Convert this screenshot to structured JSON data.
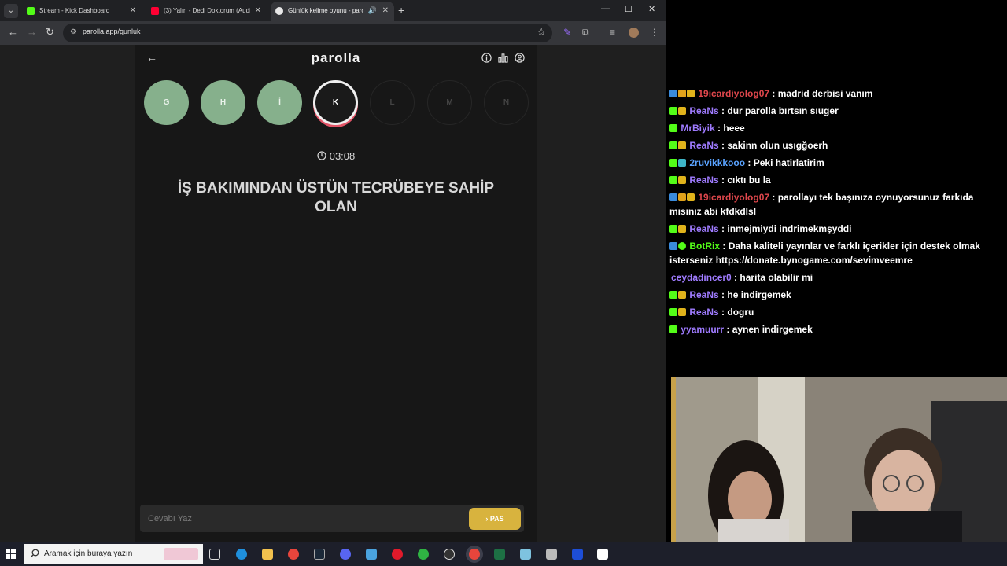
{
  "browser": {
    "tabs": [
      {
        "title": "Stream - Kick Dashboard",
        "active": false,
        "favicon_color": "#53fc18"
      },
      {
        "title": "(3) Yalın - Dedi Doktorum (Audi",
        "active": false,
        "favicon_color": "#ff0033"
      },
      {
        "title": "Günlük kelime oyunu - parc",
        "active": true,
        "favicon_color": "#e8e8e8"
      }
    ],
    "url": "parolla.app/gunluk"
  },
  "app": {
    "logo": "parolla",
    "letters": [
      {
        "char": "G",
        "state": "done"
      },
      {
        "char": "H",
        "state": "done"
      },
      {
        "char": "İ",
        "state": "done"
      },
      {
        "char": "K",
        "state": "current"
      },
      {
        "char": "L",
        "state": "pending"
      },
      {
        "char": "M",
        "state": "pending"
      },
      {
        "char": "N",
        "state": "pending"
      }
    ],
    "timer": "03:08",
    "question": "İŞ BAKIMINDAN ÜSTÜN TECRÜBEYE SAHİP OLAN",
    "answer_placeholder": "Cevabı Yaz",
    "pass_label": "PAS",
    "colors": {
      "done": "#86b08c",
      "current_ring": "#e45568",
      "pass": "#d8b33e"
    }
  },
  "chat": {
    "messages": [
      {
        "user": "19icardiyolog07",
        "color": "#e0474c",
        "text": "madrid derbisi vanım"
      },
      {
        "user": "ReaNs",
        "color": "#9f7bff",
        "text": "dur parolla bırtsın sıuger"
      },
      {
        "user": "MrBiyik",
        "color": "#9f7bff",
        "text": "heee"
      },
      {
        "user": "ReaNs",
        "color": "#9f7bff",
        "text": "sakinn olun usıgğoerh"
      },
      {
        "user": "2ruvikkkooo",
        "color": "#5aa3ff",
        "text": "Peki hatirlatirim"
      },
      {
        "user": "ReaNs",
        "color": "#9f7bff",
        "text": "cıktı bu la"
      },
      {
        "user": "19icardiyolog07",
        "color": "#e0474c",
        "text": "parollayı tek başınıza oynuyorsunuz farkıda mısınız abi kfdkdlsl"
      },
      {
        "user": "ReaNs",
        "color": "#9f7bff",
        "text": "inmejmiydi indrimekmşyddi"
      },
      {
        "user": "BotRix",
        "color": "#53fc18",
        "text": "Daha kaliteli yayınlar ve farklı içerikler için destek olmak isterseniz https://donate.bynogame.com/sevimveemre"
      },
      {
        "user": "ceydadincer0",
        "color": "#9f7bff",
        "text": "harita olabilir mi"
      },
      {
        "user": "ReaNs",
        "color": "#9f7bff",
        "text": "he indirgemek"
      },
      {
        "user": "ReaNs",
        "color": "#9f7bff",
        "text": "dogru"
      },
      {
        "user": "yyamuurr",
        "color": "#9f7bff",
        "text": "aynen indirgemek"
      }
    ]
  },
  "taskbar": {
    "search_placeholder": "Aramak için buraya yazın"
  }
}
